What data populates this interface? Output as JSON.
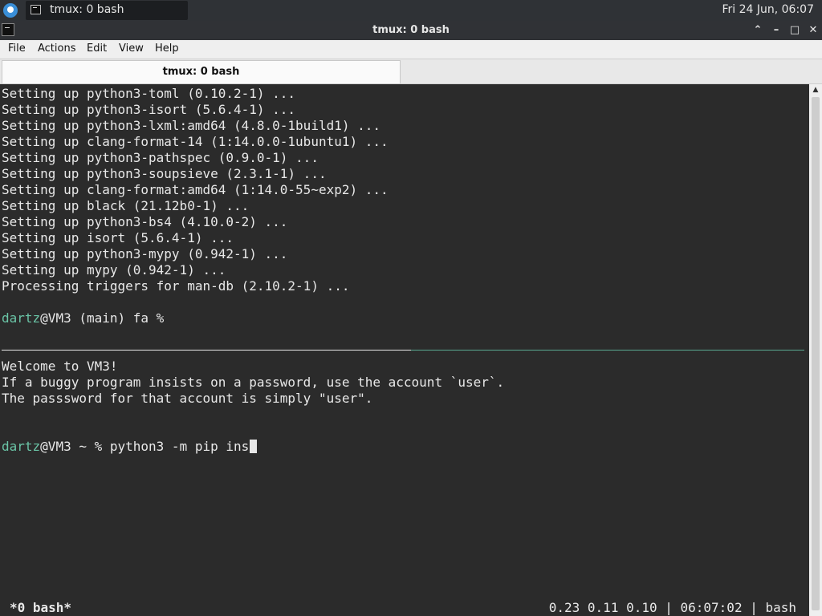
{
  "taskbar": {
    "task_label": "tmux: 0 bash",
    "clock": "Fri 24 Jun, 06:07"
  },
  "window": {
    "title": "tmux: 0 bash",
    "btn_shade": "⌃",
    "btn_minimize": "–",
    "btn_maximize": "□",
    "btn_close": "✕"
  },
  "menubar": {
    "file": "File",
    "actions": "Actions",
    "edit": "Edit",
    "view": "View",
    "help": "Help"
  },
  "tabs": [
    {
      "label": "tmux: 0 bash"
    }
  ],
  "terminal": {
    "lines": [
      "Setting up python3-toml (0.10.2-1) ...",
      "Setting up python3-isort (5.6.4-1) ...",
      "Setting up python3-lxml:amd64 (4.8.0-1build1) ...",
      "Setting up clang-format-14 (1:14.0.0-1ubuntu1) ...",
      "Setting up python3-pathspec (0.9.0-1) ...",
      "Setting up python3-soupsieve (2.3.1-1) ...",
      "Setting up clang-format:amd64 (1:14.0-55~exp2) ...",
      "Setting up black (21.12b0-1) ...",
      "Setting up python3-bs4 (4.10.0-2) ...",
      "Setting up isort (5.6.4-1) ...",
      "Setting up python3-mypy (0.942-1) ...",
      "Setting up mypy (0.942-1) ...",
      "Processing triggers for man-db (2.10.2-1) ..."
    ],
    "prompt1": {
      "user": "dartz",
      "rest": "@VM3 (main) fa %"
    },
    "welcome": [
      "Welcome to VM3!",
      "If a buggy program insists on a password, use the account `user`.",
      "The passsword for that account is simply \"user\"."
    ],
    "prompt2": {
      "user": "dartz",
      "rest": "@VM3 ~ % python3 -m pip ins"
    },
    "status_left": "*0 bash*",
    "status_right": "0.23 0.11 0.10 | 06:07:02 | bash"
  },
  "scrollbar": {
    "up_arrow": "▲"
  },
  "colors": {
    "terminal_bg": "#2b2b2b",
    "terminal_fg": "#e8e8e8",
    "prompt_user": "#6ac4a6",
    "active_pane_border": "#5aa890"
  }
}
